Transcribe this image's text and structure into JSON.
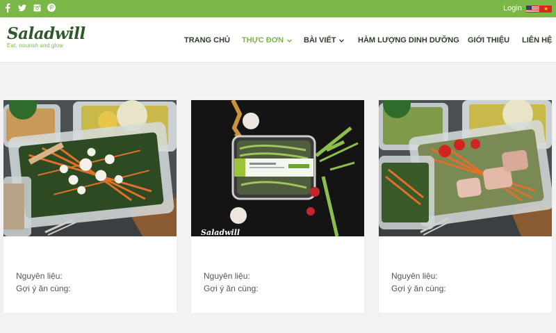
{
  "topbar": {
    "social": [
      {
        "icon": "facebook-icon",
        "glyph": "f"
      },
      {
        "icon": "twitter-icon",
        "glyph": ""
      },
      {
        "icon": "instagram-icon",
        "glyph": ""
      },
      {
        "icon": "pinterest-icon",
        "glyph": ""
      }
    ],
    "login_label": "Login",
    "languages": [
      "us-flag-icon",
      "vn-flag-icon"
    ],
    "color": "#7ab648"
  },
  "header": {
    "logo_name": "Saladwill",
    "logo_tagline": "Eat, nourish and glow",
    "nav": [
      {
        "label": "TRANG CHỦ",
        "dropdown": false,
        "active": false
      },
      {
        "label": "THỰC ĐƠN",
        "dropdown": true,
        "active": true
      },
      {
        "label": "BÀI VIẾT",
        "dropdown": true,
        "active": false
      },
      {
        "label": "HÀM LƯỢNG DINH DƯỠNG",
        "dropdown": false,
        "active": false
      },
      {
        "label": "GIỚI THIỆU",
        "dropdown": false,
        "active": false
      },
      {
        "label": "LIÊN HỆ",
        "dropdown": false,
        "active": false
      }
    ]
  },
  "cards": [
    {
      "image": "salad-boxes-photo",
      "ingredients_label": "Nguyên liệu:",
      "pairing_label": "Gợi ý ăn cùng:"
    },
    {
      "image": "microgreens-box-photo",
      "ingredients_label": "Nguyên liệu:",
      "pairing_label": "Gợi ý ăn cùng:",
      "watermark": "Saladwill"
    },
    {
      "image": "salad-boxes-photo",
      "ingredients_label": "Nguyên liệu:",
      "pairing_label": "Gợi ý ăn cùng:"
    }
  ],
  "colors": {
    "accent": "#7ab648",
    "dark_green": "#2e5a2b",
    "nav_text": "#2d3d2a",
    "background": "#f2f2f2"
  }
}
